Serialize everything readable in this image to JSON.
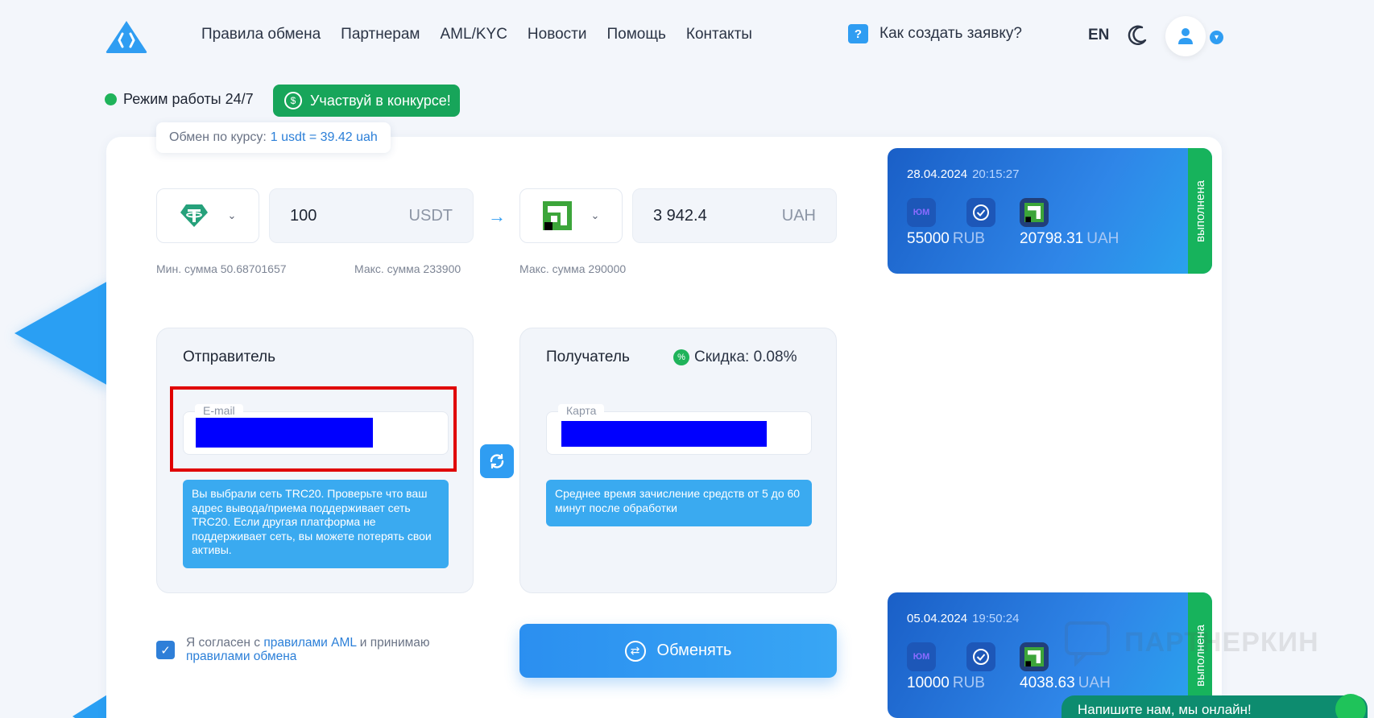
{
  "nav": {
    "items": [
      "Правила обмена",
      "Партнерам",
      "AML/KYC",
      "Новости",
      "Помощь",
      "Контакты"
    ],
    "howto_label": "Как создать заявку?",
    "lang": "EN"
  },
  "status": {
    "mode_label": "Режим работы 24/7",
    "contest_label": "Участвуй в конкурсе!"
  },
  "rate": {
    "label": "Обмен по курсу:",
    "value": "1 usdt = 39.42 uah"
  },
  "exchange": {
    "send_amount": "100",
    "send_currency": "USDT",
    "receive_amount": "3 942.4",
    "receive_currency": "UAH",
    "send_min": "Мин. сумма 50.68701657",
    "send_max": "Макс. сумма 233900",
    "receive_max": "Макс. сумма 290000"
  },
  "sender": {
    "title": "Отправитель",
    "field_label": "E-mail",
    "notice": "Вы выбрали сеть TRC20. Проверьте что ваш адрес вывода/приема поддерживает сеть TRC20. Если другая платформа не поддерживает сеть, вы можете потерять свои активы."
  },
  "receiver": {
    "title": "Получатель",
    "discount": "Скидка: 0.08%",
    "field_label": "Карта",
    "notice": "Среднее время зачисление средств от 5 до 60 минут после обработки"
  },
  "agreement": {
    "prefix": "Я согласен с",
    "aml_link": "правилами AML",
    "middle": "и принимаю",
    "rules_link": "правилами обмена"
  },
  "submit_label": "Обменять",
  "orders": [
    {
      "date": "28.04.2024",
      "time": "20:15:27",
      "status": "выполнена",
      "from_amount": "55000",
      "from_cur": "RUB",
      "to_amount": "20798.31",
      "to_cur": "UAH"
    },
    {
      "date": "05.04.2024",
      "time": "19:50:24",
      "status": "выполнена",
      "from_amount": "10000",
      "from_cur": "RUB",
      "to_amount": "4038.63",
      "to_cur": "UAH"
    }
  ],
  "chat_label": "Напишите нам, мы онлайн!",
  "watermark": "ПАРТНЕРКИН",
  "colors": {
    "accent": "#2f9df2",
    "success": "#17a55a",
    "highlight": "#e00000",
    "redaction": "#0000ff"
  }
}
